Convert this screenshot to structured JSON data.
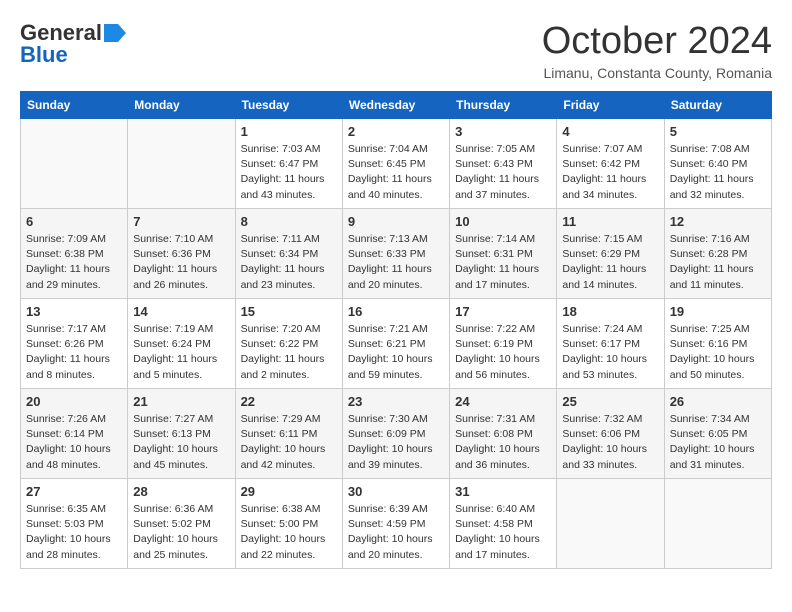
{
  "header": {
    "logo_line1": "General",
    "logo_line2": "Blue",
    "month": "October 2024",
    "location": "Limanu, Constanta County, Romania"
  },
  "days_of_week": [
    "Sunday",
    "Monday",
    "Tuesday",
    "Wednesday",
    "Thursday",
    "Friday",
    "Saturday"
  ],
  "weeks": [
    [
      {
        "day": "",
        "info": ""
      },
      {
        "day": "",
        "info": ""
      },
      {
        "day": "1",
        "info": "Sunrise: 7:03 AM\nSunset: 6:47 PM\nDaylight: 11 hours and 43 minutes."
      },
      {
        "day": "2",
        "info": "Sunrise: 7:04 AM\nSunset: 6:45 PM\nDaylight: 11 hours and 40 minutes."
      },
      {
        "day": "3",
        "info": "Sunrise: 7:05 AM\nSunset: 6:43 PM\nDaylight: 11 hours and 37 minutes."
      },
      {
        "day": "4",
        "info": "Sunrise: 7:07 AM\nSunset: 6:42 PM\nDaylight: 11 hours and 34 minutes."
      },
      {
        "day": "5",
        "info": "Sunrise: 7:08 AM\nSunset: 6:40 PM\nDaylight: 11 hours and 32 minutes."
      }
    ],
    [
      {
        "day": "6",
        "info": "Sunrise: 7:09 AM\nSunset: 6:38 PM\nDaylight: 11 hours and 29 minutes."
      },
      {
        "day": "7",
        "info": "Sunrise: 7:10 AM\nSunset: 6:36 PM\nDaylight: 11 hours and 26 minutes."
      },
      {
        "day": "8",
        "info": "Sunrise: 7:11 AM\nSunset: 6:34 PM\nDaylight: 11 hours and 23 minutes."
      },
      {
        "day": "9",
        "info": "Sunrise: 7:13 AM\nSunset: 6:33 PM\nDaylight: 11 hours and 20 minutes."
      },
      {
        "day": "10",
        "info": "Sunrise: 7:14 AM\nSunset: 6:31 PM\nDaylight: 11 hours and 17 minutes."
      },
      {
        "day": "11",
        "info": "Sunrise: 7:15 AM\nSunset: 6:29 PM\nDaylight: 11 hours and 14 minutes."
      },
      {
        "day": "12",
        "info": "Sunrise: 7:16 AM\nSunset: 6:28 PM\nDaylight: 11 hours and 11 minutes."
      }
    ],
    [
      {
        "day": "13",
        "info": "Sunrise: 7:17 AM\nSunset: 6:26 PM\nDaylight: 11 hours and 8 minutes."
      },
      {
        "day": "14",
        "info": "Sunrise: 7:19 AM\nSunset: 6:24 PM\nDaylight: 11 hours and 5 minutes."
      },
      {
        "day": "15",
        "info": "Sunrise: 7:20 AM\nSunset: 6:22 PM\nDaylight: 11 hours and 2 minutes."
      },
      {
        "day": "16",
        "info": "Sunrise: 7:21 AM\nSunset: 6:21 PM\nDaylight: 10 hours and 59 minutes."
      },
      {
        "day": "17",
        "info": "Sunrise: 7:22 AM\nSunset: 6:19 PM\nDaylight: 10 hours and 56 minutes."
      },
      {
        "day": "18",
        "info": "Sunrise: 7:24 AM\nSunset: 6:17 PM\nDaylight: 10 hours and 53 minutes."
      },
      {
        "day": "19",
        "info": "Sunrise: 7:25 AM\nSunset: 6:16 PM\nDaylight: 10 hours and 50 minutes."
      }
    ],
    [
      {
        "day": "20",
        "info": "Sunrise: 7:26 AM\nSunset: 6:14 PM\nDaylight: 10 hours and 48 minutes."
      },
      {
        "day": "21",
        "info": "Sunrise: 7:27 AM\nSunset: 6:13 PM\nDaylight: 10 hours and 45 minutes."
      },
      {
        "day": "22",
        "info": "Sunrise: 7:29 AM\nSunset: 6:11 PM\nDaylight: 10 hours and 42 minutes."
      },
      {
        "day": "23",
        "info": "Sunrise: 7:30 AM\nSunset: 6:09 PM\nDaylight: 10 hours and 39 minutes."
      },
      {
        "day": "24",
        "info": "Sunrise: 7:31 AM\nSunset: 6:08 PM\nDaylight: 10 hours and 36 minutes."
      },
      {
        "day": "25",
        "info": "Sunrise: 7:32 AM\nSunset: 6:06 PM\nDaylight: 10 hours and 33 minutes."
      },
      {
        "day": "26",
        "info": "Sunrise: 7:34 AM\nSunset: 6:05 PM\nDaylight: 10 hours and 31 minutes."
      }
    ],
    [
      {
        "day": "27",
        "info": "Sunrise: 6:35 AM\nSunset: 5:03 PM\nDaylight: 10 hours and 28 minutes."
      },
      {
        "day": "28",
        "info": "Sunrise: 6:36 AM\nSunset: 5:02 PM\nDaylight: 10 hours and 25 minutes."
      },
      {
        "day": "29",
        "info": "Sunrise: 6:38 AM\nSunset: 5:00 PM\nDaylight: 10 hours and 22 minutes."
      },
      {
        "day": "30",
        "info": "Sunrise: 6:39 AM\nSunset: 4:59 PM\nDaylight: 10 hours and 20 minutes."
      },
      {
        "day": "31",
        "info": "Sunrise: 6:40 AM\nSunset: 4:58 PM\nDaylight: 10 hours and 17 minutes."
      },
      {
        "day": "",
        "info": ""
      },
      {
        "day": "",
        "info": ""
      }
    ]
  ]
}
